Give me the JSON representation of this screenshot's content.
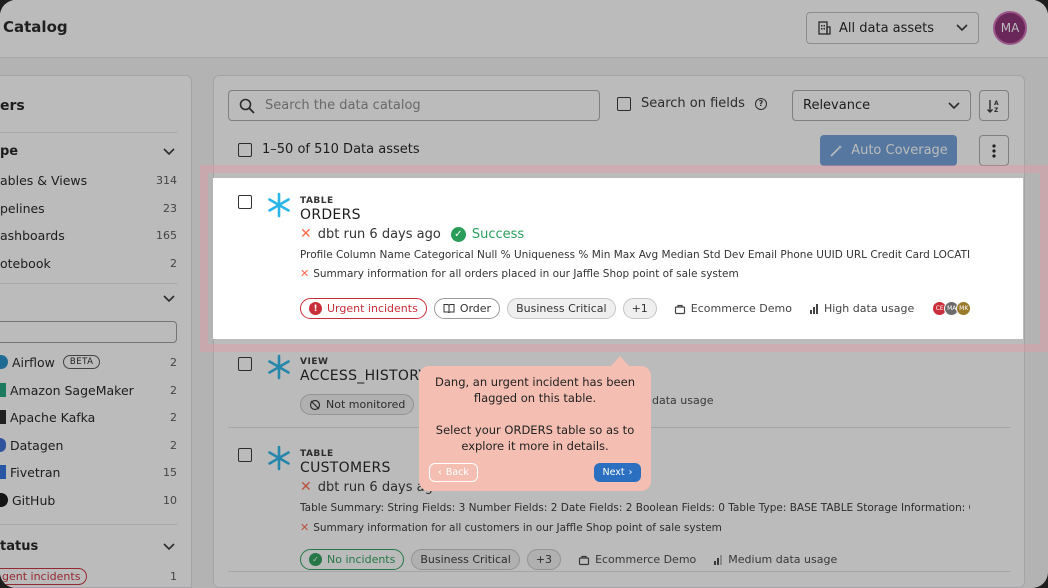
{
  "app": {
    "title": "Catalog"
  },
  "header": {
    "assets_select": "All data assets",
    "avatar": "MA"
  },
  "sidebar": {
    "title": "ers",
    "type_section": "pe",
    "types": [
      {
        "label": "ables & Views",
        "count": "314"
      },
      {
        "label": "pelines",
        "count": "23"
      },
      {
        "label": "ashboards",
        "count": "165"
      },
      {
        "label": "otebook",
        "count": "2"
      }
    ],
    "tools": [
      {
        "label": "Airflow",
        "count": "2",
        "badge": "BETA",
        "color": "#1f8fc7"
      },
      {
        "label": "Amazon SageMaker",
        "count": "2",
        "color": "#1ca47a"
      },
      {
        "label": "Apache Kafka",
        "count": "2",
        "color": "#222222"
      },
      {
        "label": "Datagen",
        "count": "2",
        "color": "#3a6ad6"
      },
      {
        "label": "Fivetran",
        "count": "15",
        "color": "#2c6fe0"
      },
      {
        "label": "GitHub",
        "count": "10",
        "color": "#111111"
      }
    ],
    "status_section": "tatus",
    "status_item": {
      "label": "gent incidents",
      "count": "1"
    }
  },
  "toolbar": {
    "search_placeholder": "Search the data catalog",
    "search_on_fields": "Search on fields",
    "sort": "Relevance",
    "count": "1–50 of 510 Data assets",
    "auto_coverage": "Auto Coverage"
  },
  "cards": [
    {
      "type": "TABLE",
      "name": "ORDERS",
      "run": "dbt run 6 days ago",
      "status": "Success",
      "desc": "Profile Column Name Categorical Null % Uniqueness % Min Max Avg Median Std Dev Email Phone UUID URL Credit Card LOCATION_NAME ...",
      "summary": "Summary information for all orders placed in our Jaffle Shop point of sale system",
      "tags": [
        "Urgent incidents",
        "Order",
        "Business Critical",
        "+1"
      ],
      "domain": "Ecommerce Demo",
      "usage": "High data usage",
      "owners": [
        "CE",
        "MA",
        "MK"
      ]
    },
    {
      "type": "VIEW",
      "name": "ACCESS_HISTORY",
      "tag": "Not monitored",
      "usage_fragment": "data usage"
    },
    {
      "type": "TABLE",
      "name": "CUSTOMERS",
      "run": "dbt run 6 days ago",
      "desc": "Table Summary: String Fields: 3 Number Fields: 2 Date Fields: 2 Boolean Fields: 0 Table Type: BASE TABLE Storage Information: Created On...",
      "summary": "Summary information for all customers in our Jaffle Shop point of sale system",
      "tags": [
        "No incidents",
        "Business Critical",
        "+3"
      ],
      "domain": "Ecommerce Demo",
      "usage": "Medium data usage"
    }
  ],
  "tour": {
    "line1": "Dang, an urgent incident has been flagged on this table.",
    "line2": "Select your ORDERS table so as to explore it more in details.",
    "back": "Back",
    "next": "Next"
  }
}
